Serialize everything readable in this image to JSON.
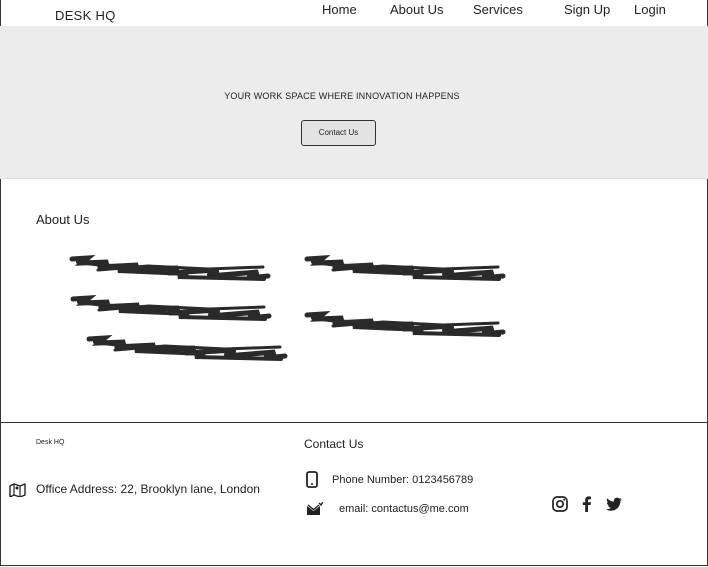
{
  "header": {
    "brand": "DESK HQ",
    "nav": [
      "Home",
      "About Us",
      "Services",
      "Sign Up",
      "Login"
    ]
  },
  "hero": {
    "title": "YOUR WORK SPACE WHERE INNOVATION HAPPENS",
    "button_label": "Contact Us"
  },
  "about": {
    "heading": "About Us",
    "placeholder_icon": "scribble-text-placeholder"
  },
  "footer": {
    "brand": "Desk HQ",
    "contact_heading": "Contact Us",
    "address": "Office Address: 22, Brooklyn lane, London",
    "phone": "Phone Number: 0123456789",
    "email": "email: contactus@me.com",
    "icons": [
      "map-icon",
      "phone-icon",
      "mail-icon",
      "instagram-icon",
      "facebook-icon",
      "twitter-icon"
    ]
  }
}
